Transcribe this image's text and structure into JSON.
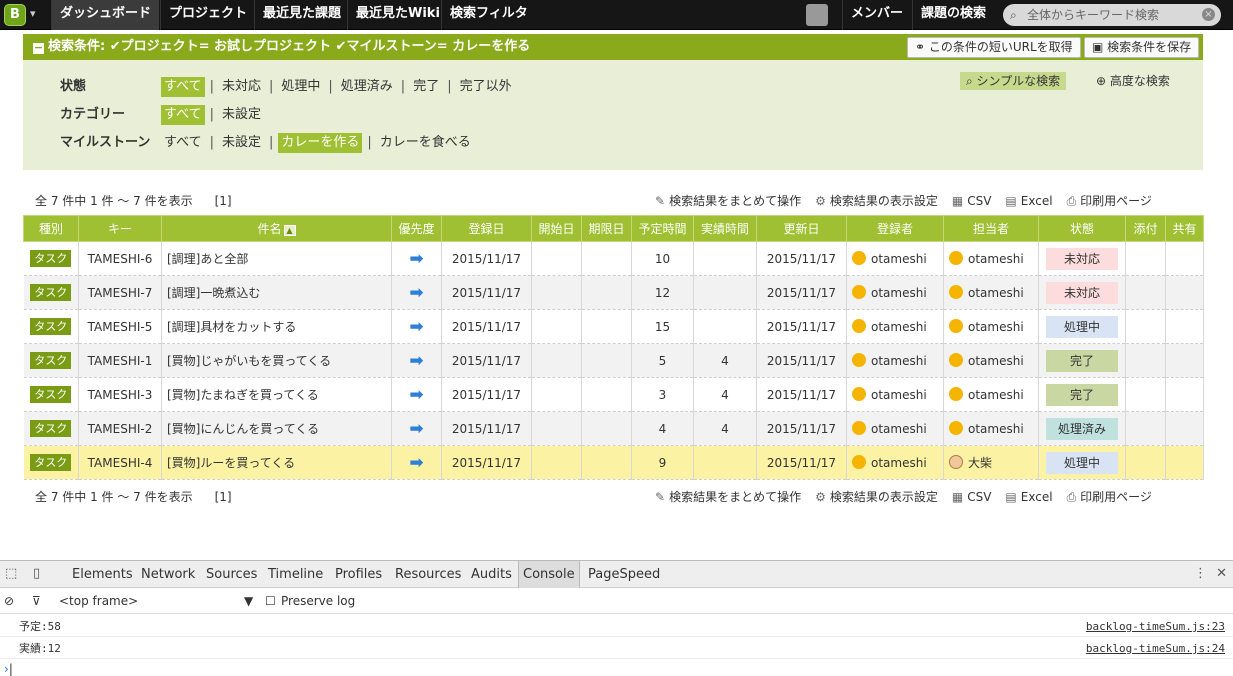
{
  "topnav": {
    "logo": "B",
    "items": [
      "ダッシュボード",
      "プロジェクト",
      "最近見た課題",
      "最近見たWiki",
      "検索フィルタ"
    ],
    "right_items": [
      "メンバー",
      "課題の検索"
    ],
    "search_placeholder": "全体からキーワード検索"
  },
  "condition": {
    "text": "検索条件: ✔プロジェクト= お試しプロジェクト ✔マイルストーン= カレーを作る",
    "short_url_button": "この条件の短いURLを取得",
    "save_button": "検索条件を保存"
  },
  "filters": {
    "simple_search": "シンプルな検索",
    "advanced_search": "高度な検索",
    "rows": [
      {
        "label": "状態",
        "options": [
          "すべて",
          "未対応",
          "処理中",
          "処理済み",
          "完了",
          "完了以外"
        ],
        "selected": 0
      },
      {
        "label": "カテゴリー",
        "options": [
          "すべて",
          "未設定"
        ],
        "selected": 0
      },
      {
        "label": "マイルストーン",
        "options": [
          "すべて",
          "未設定",
          "カレーを作る",
          "カレーを食べる"
        ],
        "selected": 2
      }
    ]
  },
  "summary": {
    "count_text": "全 7 件中 1 件 〜 7 件を表示",
    "pages": "[1]"
  },
  "tools": [
    "検索結果をまとめて操作",
    "検索結果の表示設定",
    "CSV",
    "Excel",
    "印刷用ページ"
  ],
  "table": {
    "headers": [
      "種別",
      "キー",
      "件名",
      "優先度",
      "登録日",
      "開始日",
      "期限日",
      "予定時間",
      "実績時間",
      "更新日",
      "登録者",
      "担当者",
      "状態",
      "添付",
      "共有"
    ],
    "rows": [
      {
        "type": "タスク",
        "key": "TAMESHI-6",
        "subject": "[調理]あと全部",
        "created": "2015/11/17",
        "start": "",
        "due": "",
        "estimated": "10",
        "actual": "",
        "updated": "2015/11/17",
        "creator": "otameshi",
        "assignee": "otameshi",
        "assignee_icon": "user-icon",
        "status": "未対応",
        "status_color": "#fcdcdc"
      },
      {
        "type": "タスク",
        "key": "TAMESHI-7",
        "subject": "[調理]一晩煮込む",
        "created": "2015/11/17",
        "start": "",
        "due": "",
        "estimated": "12",
        "actual": "",
        "updated": "2015/11/17",
        "creator": "otameshi",
        "assignee": "otameshi",
        "assignee_icon": "user-icon",
        "status": "未対応",
        "status_color": "#fcdcdc"
      },
      {
        "type": "タスク",
        "key": "TAMESHI-5",
        "subject": "[調理]具材をカットする",
        "created": "2015/11/17",
        "start": "",
        "due": "",
        "estimated": "15",
        "actual": "",
        "updated": "2015/11/17",
        "creator": "otameshi",
        "assignee": "otameshi",
        "assignee_icon": "user-icon",
        "status": "処理中",
        "status_color": "#d8e4f4"
      },
      {
        "type": "タスク",
        "key": "TAMESHI-1",
        "subject": "[買物]じゃがいもを買ってくる",
        "created": "2015/11/17",
        "start": "",
        "due": "",
        "estimated": "5",
        "actual": "4",
        "updated": "2015/11/17",
        "creator": "otameshi",
        "assignee": "otameshi",
        "assignee_icon": "user-icon",
        "status": "完了",
        "status_color": "#c9d7a3"
      },
      {
        "type": "タスク",
        "key": "TAMESHI-3",
        "subject": "[買物]たまねぎを買ってくる",
        "created": "2015/11/17",
        "start": "",
        "due": "",
        "estimated": "3",
        "actual": "4",
        "updated": "2015/11/17",
        "creator": "otameshi",
        "assignee": "otameshi",
        "assignee_icon": "user-icon",
        "status": "完了",
        "status_color": "#c9d7a3"
      },
      {
        "type": "タスク",
        "key": "TAMESHI-2",
        "subject": "[買物]にんじんを買ってくる",
        "created": "2015/11/17",
        "start": "",
        "due": "",
        "estimated": "4",
        "actual": "4",
        "updated": "2015/11/17",
        "creator": "otameshi",
        "assignee": "otameshi",
        "assignee_icon": "user-icon",
        "status": "処理済み",
        "status_color": "#bfe2de"
      },
      {
        "type": "タスク",
        "key": "TAMESHI-4",
        "subject": "[買物]ルーを買ってくる",
        "created": "2015/11/17",
        "start": "",
        "due": "",
        "estimated": "9",
        "actual": "",
        "updated": "2015/11/17",
        "creator": "otameshi",
        "assignee": "大柴",
        "assignee_icon": "man-avatar-icon",
        "status": "処理中",
        "status_color": "#d8e4f4"
      }
    ]
  },
  "devtools": {
    "tabs": [
      "Elements",
      "Network",
      "Sources",
      "Timeline",
      "Profiles",
      "Resources",
      "Audits",
      "Console",
      "PageSpeed"
    ],
    "active_tab": "Console",
    "frame": "<top frame>",
    "preserve_log": "Preserve log",
    "console": [
      {
        "text": "予定:58",
        "source": "backlog-timeSum.js:23"
      },
      {
        "text": "実績:12",
        "source": "backlog-timeSum.js:24"
      }
    ]
  }
}
